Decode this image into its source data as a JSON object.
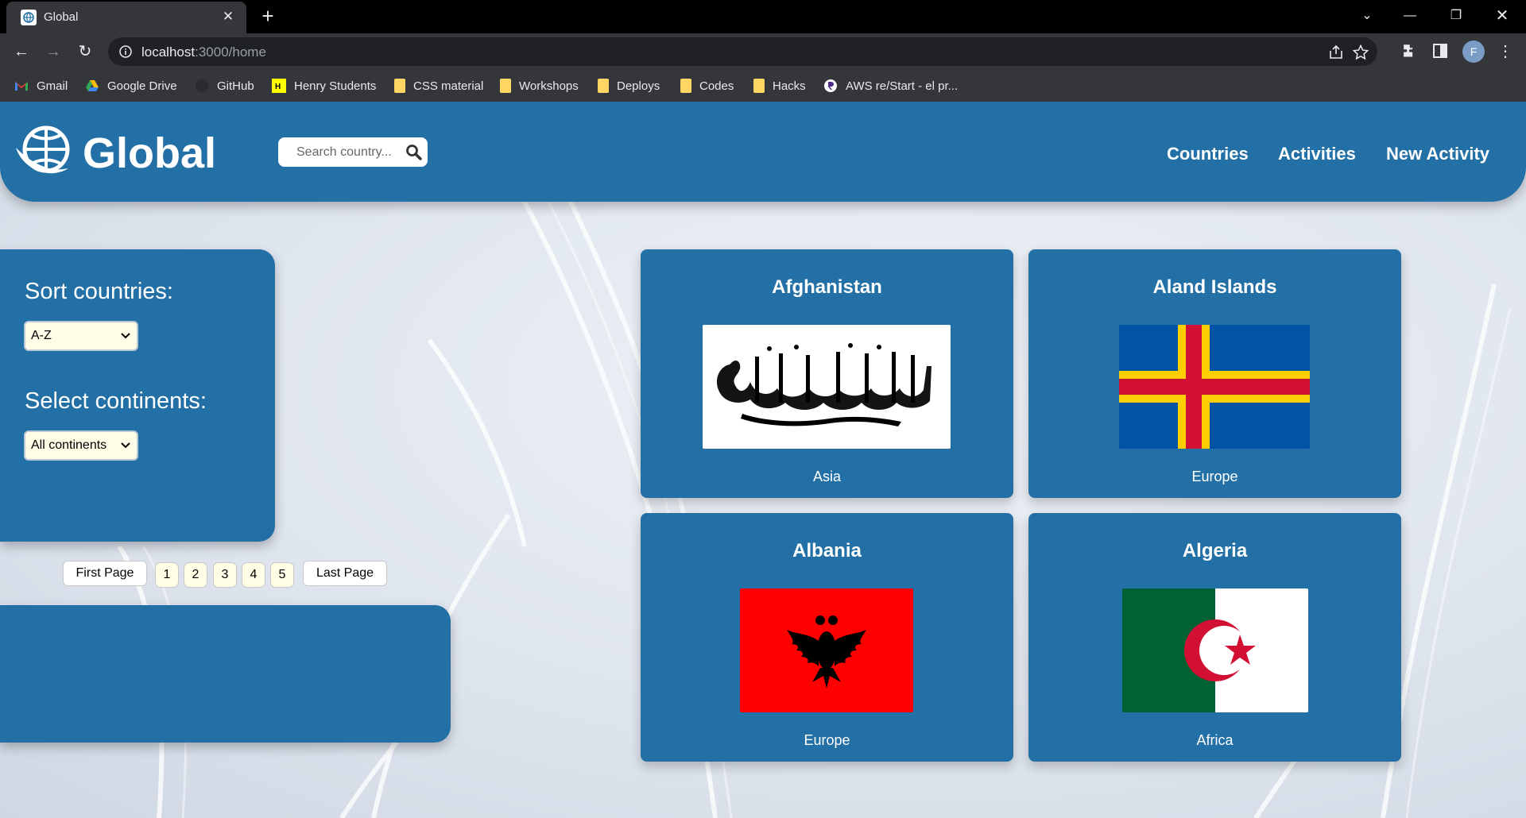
{
  "browser": {
    "tab_title": "Global",
    "url_host": "localhost",
    "url_rest": ":3000/home",
    "profile_initial": "F",
    "bookmarks": [
      "Gmail",
      "Google Drive",
      "GitHub",
      "Henry Students",
      "CSS material",
      "Workshops",
      "Deploys",
      "Codes",
      "Hacks",
      "AWS re/Start - el pr..."
    ]
  },
  "header": {
    "brand": "Global",
    "search_placeholder": "Search country...",
    "nav": [
      "Countries",
      "Activities",
      "New Activity"
    ]
  },
  "filters": {
    "sort_label": "Sort countries:",
    "sort_value": "A-Z",
    "continent_label": "Select continents:",
    "continent_value": "All continents"
  },
  "pagination": {
    "first": "First Page",
    "pages": [
      "1",
      "2",
      "3",
      "4",
      "5"
    ],
    "last": "Last Page"
  },
  "countries": [
    {
      "name": "Afghanistan",
      "continent": "Asia"
    },
    {
      "name": "Aland Islands",
      "continent": "Europe"
    },
    {
      "name": "Albania",
      "continent": "Europe"
    },
    {
      "name": "Algeria",
      "continent": "Africa"
    }
  ],
  "colors": {
    "accent": "#2370a6",
    "browser_dark": "#35363a",
    "select_bg": "#fffde6"
  }
}
